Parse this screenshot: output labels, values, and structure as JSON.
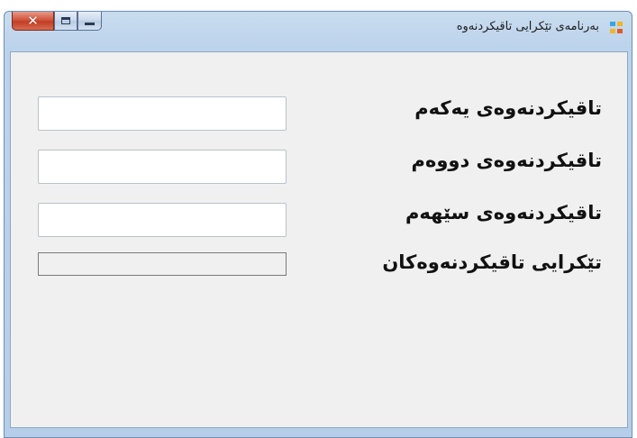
{
  "window": {
    "title": "بەرنامەی تێکرایی تاقیکردنەوە",
    "icon": "app-icon",
    "caption_buttons": {
      "close": "close-icon",
      "maximize": "maximize-icon",
      "minimize": "minimize-icon"
    }
  },
  "form": {
    "first_test_label": "تاقیکردنەوەی یەکەم",
    "second_test_label": "تاقیکردنەوەی دووەم",
    "third_test_label": "تاقیکردنەوەی سێهەم",
    "average_label": "تێکرایی تاقیکردنەوەکان",
    "first_test_value": "",
    "second_test_value": "",
    "third_test_value": "",
    "average_value": ""
  }
}
